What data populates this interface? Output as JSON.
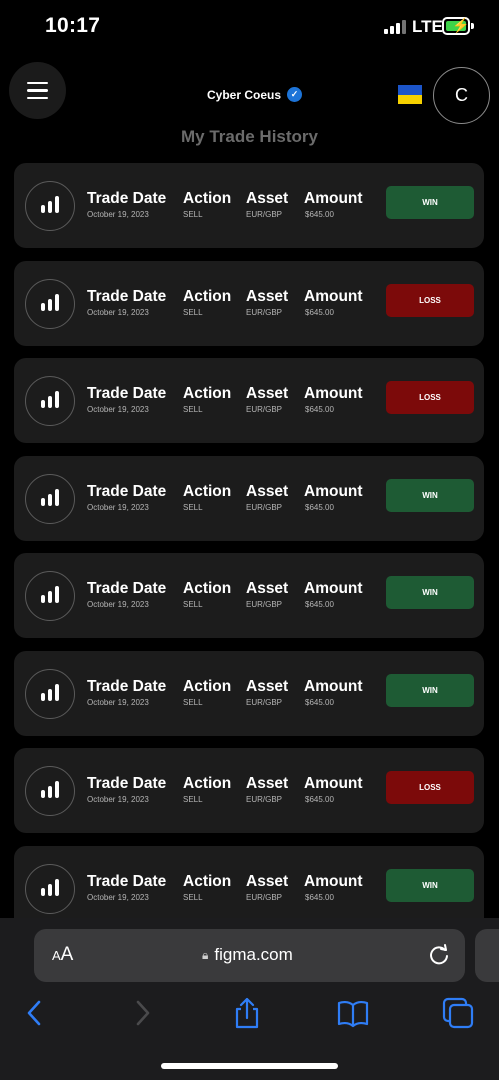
{
  "status_bar": {
    "time": "10:17",
    "network": "LTE"
  },
  "header": {
    "brand": "Cyber Coeus",
    "avatar_initial": "C"
  },
  "page_title": "My Trade History",
  "columns": {
    "date": "Trade Date",
    "action": "Action",
    "asset": "Asset",
    "amount": "Amount"
  },
  "trades": [
    {
      "date": "October 19, 2023",
      "action": "SELL",
      "asset": "EUR/GBP",
      "amount": "$645.00",
      "result": "WIN"
    },
    {
      "date": "October 19, 2023",
      "action": "SELL",
      "asset": "EUR/GBP",
      "amount": "$645.00",
      "result": "LOSS"
    },
    {
      "date": "October 19, 2023",
      "action": "SELL",
      "asset": "EUR/GBP",
      "amount": "$645.00",
      "result": "LOSS"
    },
    {
      "date": "October 19, 2023",
      "action": "SELL",
      "asset": "EUR/GBP",
      "amount": "$645.00",
      "result": "WIN"
    },
    {
      "date": "October 19, 2023",
      "action": "SELL",
      "asset": "EUR/GBP",
      "amount": "$645.00",
      "result": "WIN"
    },
    {
      "date": "October 19, 2023",
      "action": "SELL",
      "asset": "EUR/GBP",
      "amount": "$645.00",
      "result": "WIN"
    },
    {
      "date": "October 19, 2023",
      "action": "SELL",
      "asset": "EUR/GBP",
      "amount": "$645.00",
      "result": "LOSS"
    },
    {
      "date": "October 19, 2023",
      "action": "SELL",
      "asset": "EUR/GBP",
      "amount": "$645.00",
      "result": "WIN"
    }
  ],
  "browser": {
    "text_size_label": "AA",
    "url": "figma.com"
  },
  "colors": {
    "win": "#1e5b34",
    "loss": "#7c0a0a",
    "card": "#1c1c1c",
    "accent_blue": "#1d74d8"
  },
  "icons": {
    "menu": "hamburger-icon",
    "verified": "verified-badge-icon",
    "flag": "ukraine-flag-icon",
    "trade": "bar-chart-icon",
    "lock": "lock-icon",
    "reload": "reload-icon",
    "back": "chevron-left-icon",
    "forward": "chevron-right-icon",
    "share": "share-icon",
    "bookmarks": "book-icon",
    "tabs": "tabs-icon"
  }
}
